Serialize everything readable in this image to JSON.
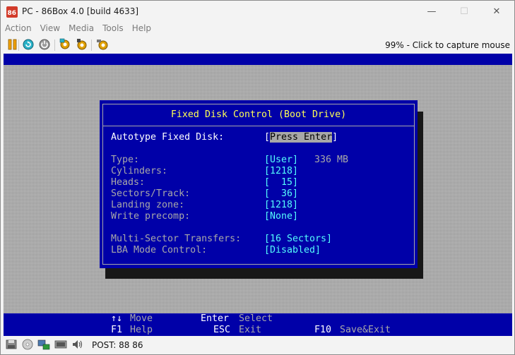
{
  "window": {
    "title": "PC - 86Box 4.0 [build 4633]",
    "minimize_glyph": "—",
    "maximize_glyph": "☐",
    "close_glyph": "✕"
  },
  "menu": [
    "Action",
    "View",
    "Media",
    "Tools",
    "Help"
  ],
  "toolbar": {
    "icons": [
      "pause-icon",
      "ctrl-alt-del-icon",
      "power-reset-icon",
      "settings-icon",
      "sound-settings-icon",
      "screenshot-icon"
    ],
    "capture_hint": "99% - Click to capture mouse"
  },
  "bios": {
    "title": "Fixed Disk Control (Boot Drive)",
    "autotype_label": "Autotype Fixed Disk:",
    "autotype_open": "[",
    "autotype_value": "Press Enter",
    "autotype_close": "]",
    "fields": [
      {
        "label": "Type:",
        "value": "[User]",
        "extra": "336 MB"
      },
      {
        "label": "Cylinders:",
        "value": "[1218]",
        "extra": ""
      },
      {
        "label": "Heads:",
        "value": "[  15]",
        "extra": ""
      },
      {
        "label": "Sectors/Track:",
        "value": "[  36]",
        "extra": ""
      },
      {
        "label": "Landing zone:",
        "value": "[1218]",
        "extra": ""
      },
      {
        "label": "Write precomp:",
        "value": "[None]",
        "extra": ""
      }
    ],
    "multi_sector_label": "Multi-Sector Transfers:",
    "multi_sector_value": "[16 Sectors]",
    "lba_label": "LBA Mode Control:",
    "lba_value": "[Disabled]",
    "help": {
      "move_key": "↑↓",
      "move_action": "Move",
      "select_key": "Enter",
      "select_action": "Select",
      "help_key": "F1",
      "help_action": "Help",
      "exit_key": "ESC",
      "exit_action": "Exit",
      "save_key": "F10",
      "save_action": "Save&Exit"
    }
  },
  "statusbar": {
    "icons": [
      "floppy-drive-icon",
      "cdrom-drive-icon",
      "network-icon",
      "hard-disk-icon",
      "sound-icon"
    ],
    "post_text": "POST: 88 86"
  }
}
